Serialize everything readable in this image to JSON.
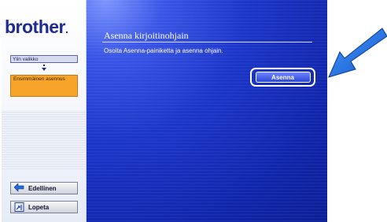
{
  "brand": {
    "logo": "brother",
    "logo_dot": "."
  },
  "sidebar": {
    "main_menu": "Ylin valikko",
    "active_step": "Ensimmäinen asennus"
  },
  "nav": {
    "back": "Edellinen",
    "quit": "Lopeta"
  },
  "content": {
    "title": "Asenna kirjoitinohjain",
    "instruction": "Osoita Asenna-painiketta ja asenna ohjain.",
    "install_button": "Asenna"
  },
  "colors": {
    "brand": "#1f2c8f",
    "content_bg": "#1c36c9",
    "active_item": "#f6a42a",
    "pointer": "#1f6fd6"
  },
  "icons": {
    "menu_down": "chevron-down-icon",
    "back": "back-arrow-icon",
    "quit": "exit-door-icon",
    "pointer": "pointer-arrow-icon"
  }
}
